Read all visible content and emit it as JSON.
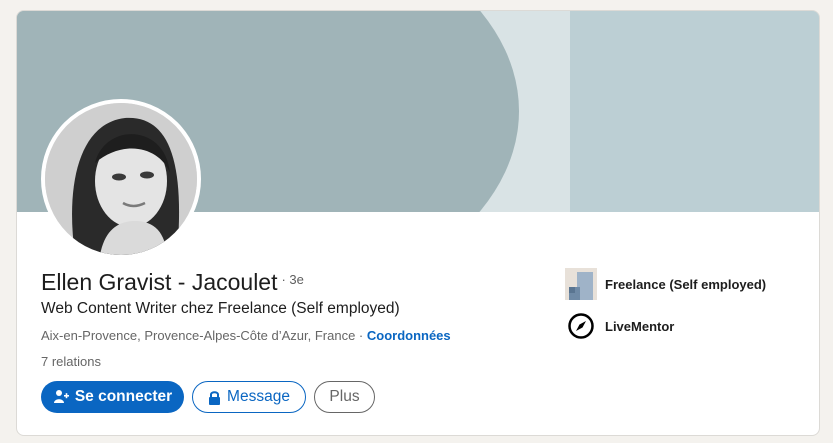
{
  "profile": {
    "name": "Ellen Gravist - Jacoulet",
    "degree": "· 3e",
    "headline": "Web Content Writer chez Freelance (Self employed)",
    "location": "Aix-en-Provence, Provence-Alpes-Côte d’Azur, France · ",
    "contact_link": "Coordonnées",
    "connections": "7 relations"
  },
  "actions": {
    "connect_label": "Se connecter",
    "message_label": "Message",
    "more_label": "Plus"
  },
  "organizations": [
    {
      "name": "Freelance (Self employed)",
      "icon": "building-logo-icon"
    },
    {
      "name": "LiveMentor",
      "icon": "compass-logo-icon"
    }
  ],
  "colors": {
    "accent": "#0a66c2",
    "banner": "#a0b4b8",
    "page_bg": "#f4f2ee"
  }
}
